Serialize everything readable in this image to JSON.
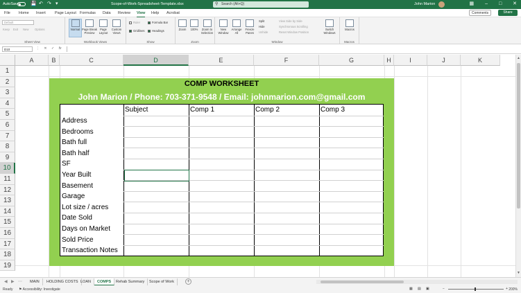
{
  "titlebar": {
    "autosave": "AutoSave",
    "autosave_state": "Off",
    "filename": "Scope-of-Work-Spreadsheet-Template.xlsx",
    "search": "Search (Alt+Q)",
    "user": "John Marion"
  },
  "ribbon_tabs": [
    "File",
    "Home",
    "Insert",
    "Page Layout",
    "Formulas",
    "Data",
    "Review",
    "View",
    "Help",
    "Acrobat"
  ],
  "active_tab": "View",
  "comments_label": "Comments",
  "share_label": "Share",
  "ribbon": {
    "sheet_view": {
      "dropdown": "Default",
      "keep": "Keep",
      "exit": "Exit",
      "new": "New",
      "options": "Options",
      "label": "Sheet View"
    },
    "workbook_views": {
      "normal": "Normal",
      "page_break": "Page Break Preview",
      "page_layout": "Page Layout",
      "custom_views": "Custom Views",
      "label": "Workbook Views"
    },
    "show": {
      "ruler": "Ruler",
      "formula_bar": "Formula Bar",
      "gridlines": "Gridlines",
      "headings": "Headings",
      "label": "Show"
    },
    "zoom": {
      "zoom": "Zoom",
      "zoom100": "100%",
      "zoom_selection": "Zoom to Selection",
      "label": "Zoom"
    },
    "window": {
      "new_window": "New Window",
      "arrange_all": "Arrange All",
      "freeze": "Freeze Panes",
      "split": "Split",
      "hide": "Hide",
      "unhide": "Unhide",
      "side_by_side": "View Side by Side",
      "sync_scroll": "Synchronous Scrolling",
      "reset_pos": "Reset Window Position",
      "switch": "Switch Windows",
      "label": "Window"
    },
    "macros": {
      "macros": "Macros",
      "label": "Macros"
    }
  },
  "formula_bar": {
    "name_box": "D10",
    "fx": "fx"
  },
  "columns": [
    "A",
    "B",
    "C",
    "D",
    "E",
    "F",
    "G",
    "H",
    "I",
    "J",
    "K"
  ],
  "selected_column": "D",
  "rows": [
    "1",
    "2",
    "3",
    "4",
    "5",
    "6",
    "7",
    "8",
    "9",
    "10",
    "11",
    "12",
    "13",
    "14",
    "15",
    "16",
    "17",
    "18",
    "19"
  ],
  "selected_row": "10",
  "worksheet": {
    "title": "COMP WORKSHEET",
    "subtitle": "John Marion / Phone: 703-371-9548 / Email: johnmarion.com@gmail.com",
    "column_headers": [
      "Subject",
      "Comp 1",
      "Comp 2",
      "Comp 3"
    ],
    "row_labels": [
      "Address",
      "Bedrooms",
      "Bath full",
      "Bath half",
      "SF",
      "Year Built",
      "Basement",
      "Garage",
      "Lot size / acres",
      "Date Sold",
      "Days on Market",
      "Sold Price",
      "Transaction Notes"
    ]
  },
  "sheet_tabs": [
    "MAIN",
    "HOLDING COSTS",
    "LOAN",
    "COMPS",
    "Rehab Summary",
    "Scope of Work"
  ],
  "active_sheet": "COMPS",
  "status": {
    "ready": "Ready",
    "accessibility": "Accessibility: Investigate",
    "zoom": "200%"
  },
  "colors": {
    "excel_green": "#217346",
    "sheet_green": "#92d050"
  }
}
